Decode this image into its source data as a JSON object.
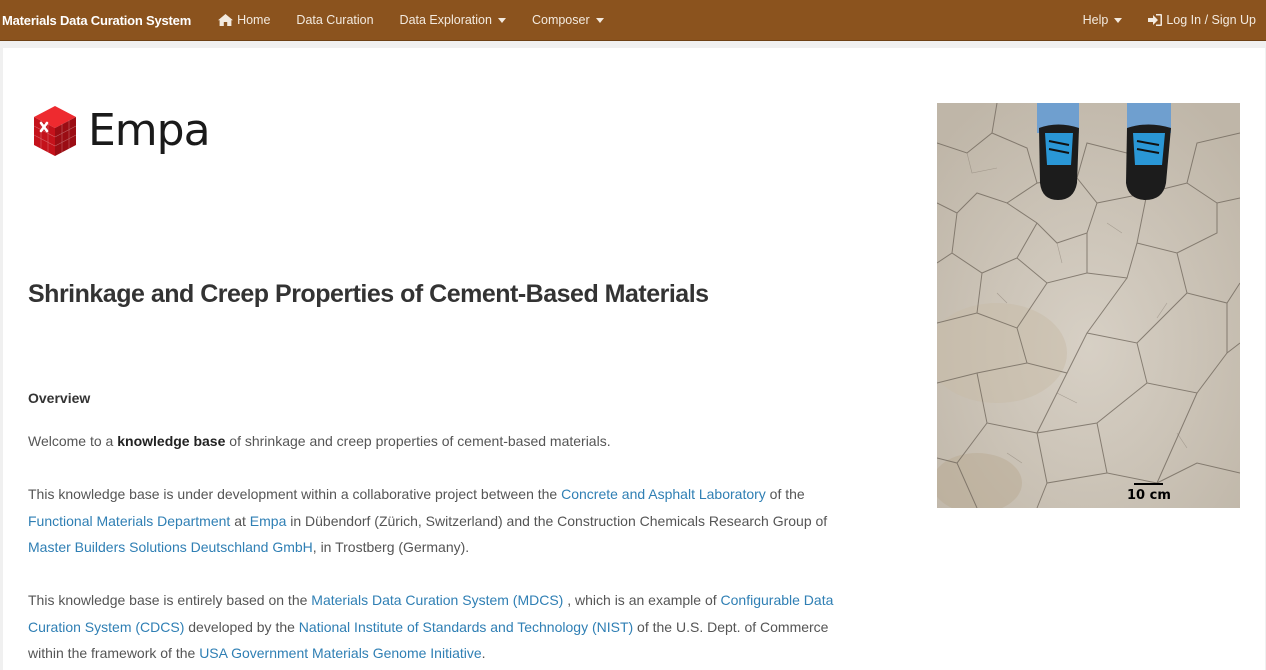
{
  "navbar": {
    "brand": "Materials Data Curation System",
    "items": [
      {
        "label": "Home",
        "icon": "home-icon"
      },
      {
        "label": "Data Curation"
      },
      {
        "label": "Data Exploration",
        "dropdown": true
      },
      {
        "label": "Composer",
        "dropdown": true
      }
    ],
    "right": [
      {
        "label": "Help",
        "dropdown": true
      },
      {
        "label": "Log In / Sign Up",
        "icon": "sign-in-icon"
      }
    ],
    "bg_color": "#8b531e"
  },
  "logo": {
    "word": "Empa",
    "color": "#d0121b"
  },
  "page_title": "Shrinkage and Creep Properties of Cement-Based Materials",
  "overview": {
    "heading": "Overview",
    "p1": {
      "pre": "Welcome to a ",
      "bold": "knowledge base",
      "post": " of shrinkage and creep properties of cement-based materials."
    },
    "p2": {
      "t1": "This knowledge base is under development within a collaborative project between the ",
      "l1": "Concrete and Asphalt Laboratory",
      "t2": " of the ",
      "l2": "Functional Materials Department",
      "t3": " at ",
      "l3": "Empa",
      "t4": " in Dübendorf (Zürich, Switzerland) and the Construction Chemicals Research Group of ",
      "l4": "Master Builders Solutions Deutschland GmbH",
      "t5": ", in Trostberg (Germany)."
    },
    "p3": {
      "t1": "This knowledge base is entirely based on the ",
      "l1": "Materials Data Curation System (MDCS)",
      "t2": " , which is an example of ",
      "l2": "Configurable Data Curation System (CDCS)",
      "t3": " developed by the ",
      "l3": "National Institute of Standards and Technology (NIST)",
      "t4": " of the U.S. Dept. of Commerce within the framework of the ",
      "l4": "USA Government Materials Genome Initiative",
      "t5": "."
    }
  },
  "photo": {
    "scale_label": "10 cm"
  },
  "link_color": "#2f7fb4"
}
